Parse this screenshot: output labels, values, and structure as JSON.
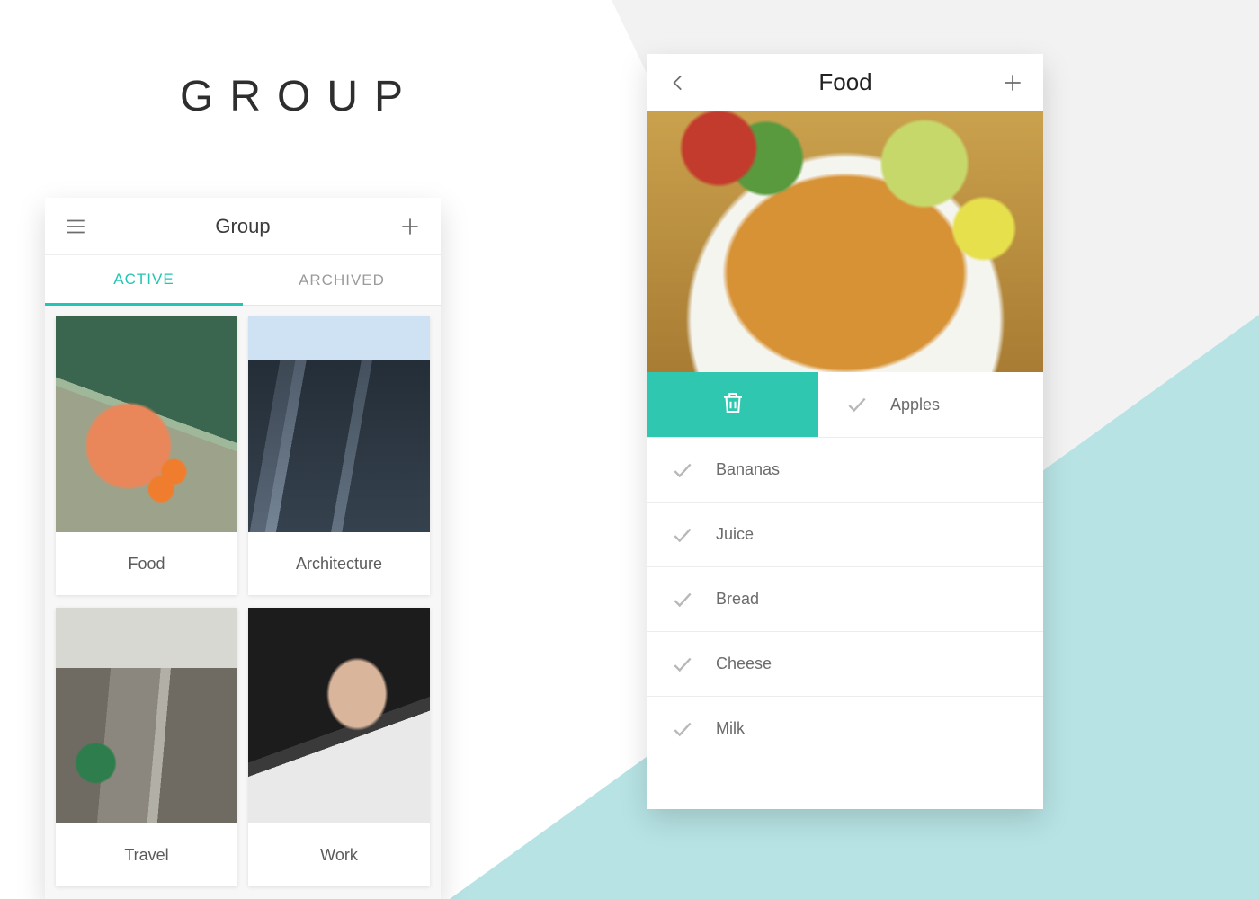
{
  "page_title": "GROUP",
  "group_screen": {
    "title": "Group",
    "tabs": {
      "active": "ACTIVE",
      "archived": "ARCHIVED"
    },
    "cards": [
      {
        "label": "Food"
      },
      {
        "label": "Architecture"
      },
      {
        "label": "Travel"
      },
      {
        "label": "Work"
      }
    ]
  },
  "food_screen": {
    "title": "Food",
    "items": [
      {
        "label": "Apples",
        "swiped": true
      },
      {
        "label": "Bananas",
        "swiped": false
      },
      {
        "label": "Juice",
        "swiped": false
      },
      {
        "label": "Bread",
        "swiped": false
      },
      {
        "label": "Cheese",
        "swiped": false
      },
      {
        "label": "Milk",
        "swiped": false
      }
    ]
  },
  "colors": {
    "accent": "#2fc7b0"
  }
}
